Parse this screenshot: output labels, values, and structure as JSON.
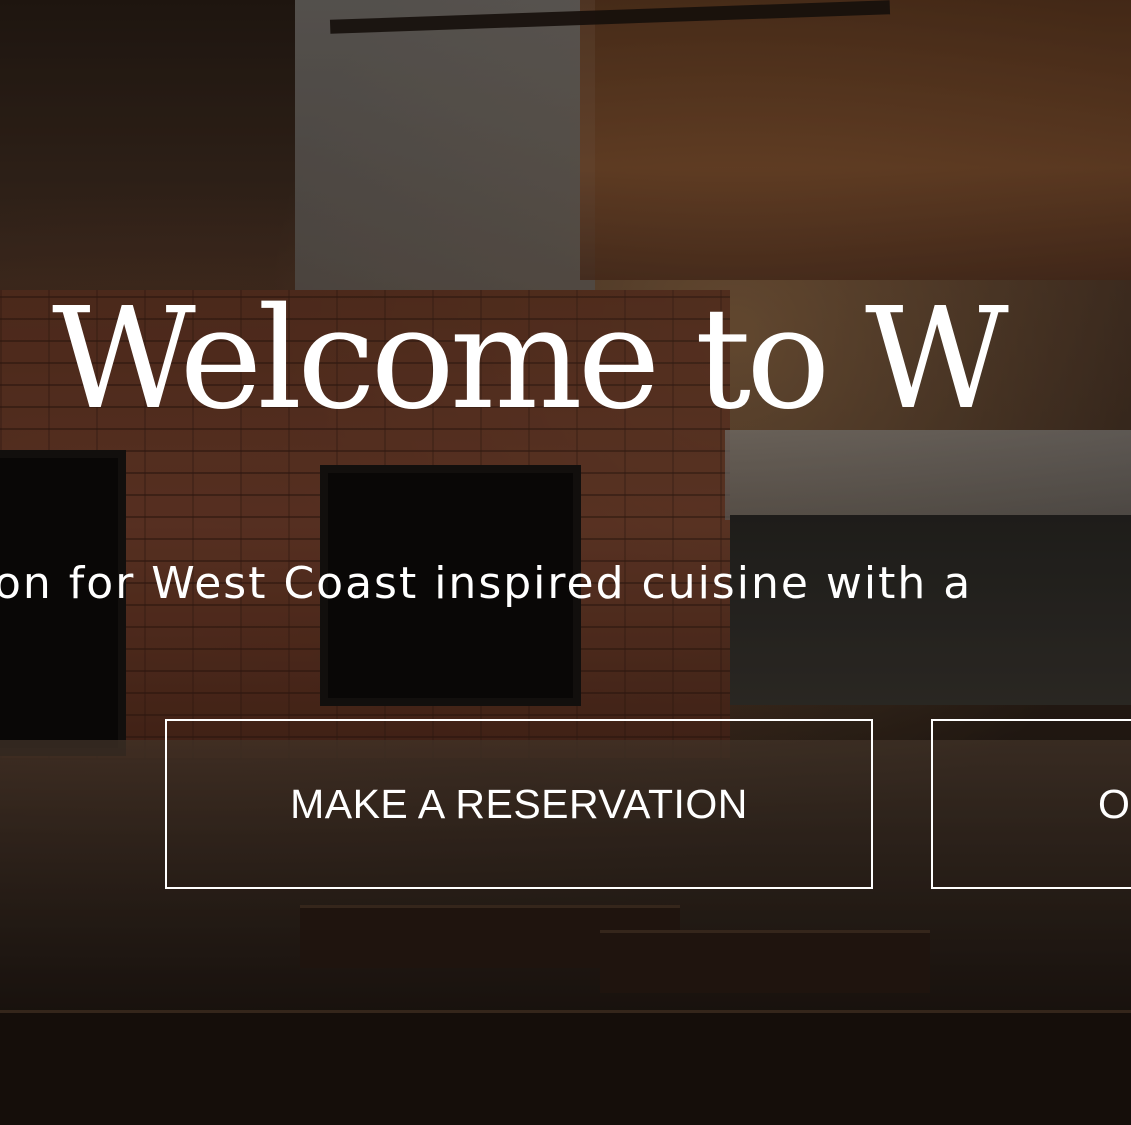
{
  "hero": {
    "headline": "Welcome to W",
    "tagline": "on for West Coast inspired cuisine with a",
    "primary_button_label": "MAKE A RESERVATION",
    "secondary_button_label": "O"
  },
  "colors": {
    "text": "#ffffff",
    "button_border": "#ffffff",
    "overlay": "#000000"
  }
}
